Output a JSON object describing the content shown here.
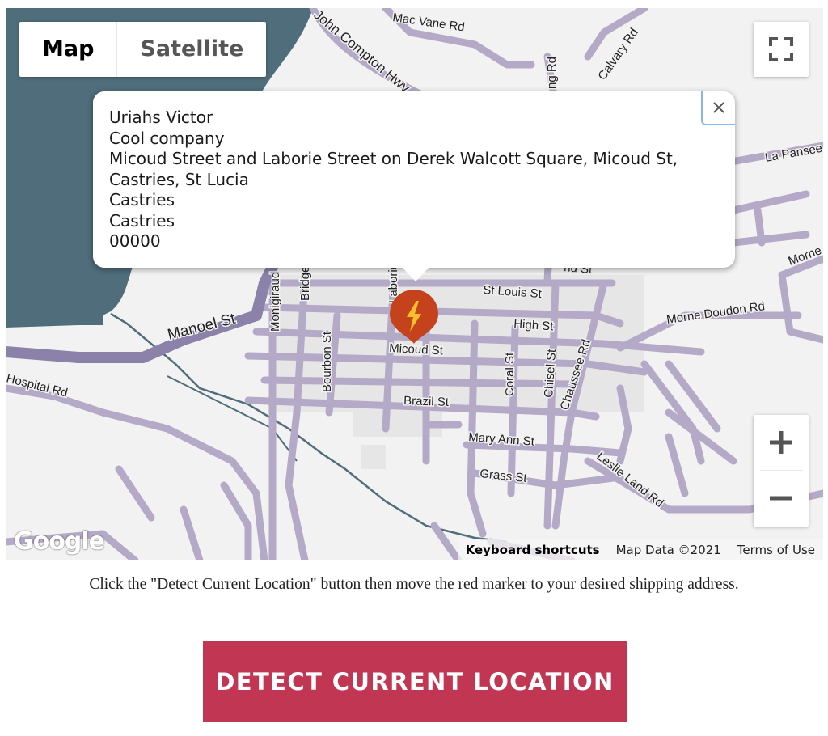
{
  "map": {
    "type_control": {
      "map_label": "Map",
      "satellite_label": "Satellite",
      "active": "Map"
    },
    "streets": {
      "mac_vane": "Mac Vane Rd",
      "john_compton": "John Compton Hwy",
      "calvary": "Calvary Rd",
      "long_rd": "ng Rd",
      "la_pansee": "La Pansee",
      "morne": "Morne",
      "st_louis": "St Louis St",
      "high": "High St",
      "micoud": "Micoud St",
      "morne_doudon": "Morne Doudon Rd",
      "manoel": "Manoel St",
      "monigiraud": "Monigiraud",
      "bridge": "Bridge",
      "laborie": "Laborie",
      "bourbon": "Bourbon St",
      "coral": "Coral St",
      "chisel": "Chisel St",
      "chaussee": "Chaussee Rd",
      "hospital": "Hospital Rd",
      "brazil": "Brazil St",
      "mary_ann": "Mary Ann St",
      "grass": "Grass St",
      "leslie_land": "Leslie Land Rd",
      "end_st": "nd St"
    },
    "marker": {
      "icon": "lightning-bolt-icon",
      "color": "#c4431c"
    },
    "info_window": {
      "lines": [
        "Uriahs Victor",
        "Cool company",
        "Micoud Street and Laborie Street on Derek Walcott Square, Micoud St,",
        "Castries, St Lucia",
        "Castries",
        "Castries",
        "00000"
      ],
      "close_icon": "close-icon"
    },
    "attribution": {
      "keyboard": "Keyboard shortcuts",
      "data": "Map Data ©2021",
      "terms": "Terms of Use"
    },
    "logo": "Google",
    "colors": {
      "road": "#b4a9c6",
      "highway": "#8a82a8",
      "water": "#4f6d7a",
      "land": "#f2f2f2",
      "block": "#e5e5e5"
    }
  },
  "instructions": "Click the \"Detect Current Location\" button then move the red marker to your desired shipping address.",
  "detect_button": {
    "label": "DETECT CURRENT LOCATION",
    "color": "#c13653"
  }
}
